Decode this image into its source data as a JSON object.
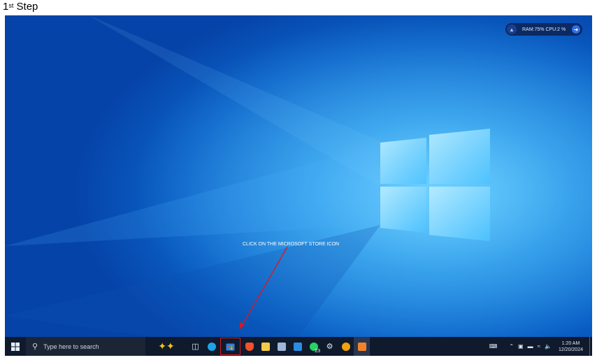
{
  "caption": {
    "text": "1",
    "ordinal": "st",
    "rest": " Step"
  },
  "perf_widget": {
    "text": "RAM:75%  CPU:2 %"
  },
  "annotation": {
    "text": "CLICK ON THE MICROSOFT STORE ICON"
  },
  "taskbar": {
    "search_placeholder": "Type here to search",
    "clock_time": "1:20 AM",
    "clock_date": "12/20/2024",
    "whatsapp_badge": "23"
  },
  "colors": {
    "highlight_box": "#e0161a",
    "arrow": "#e0161a",
    "taskbar_bg": "#0f1a2c"
  }
}
